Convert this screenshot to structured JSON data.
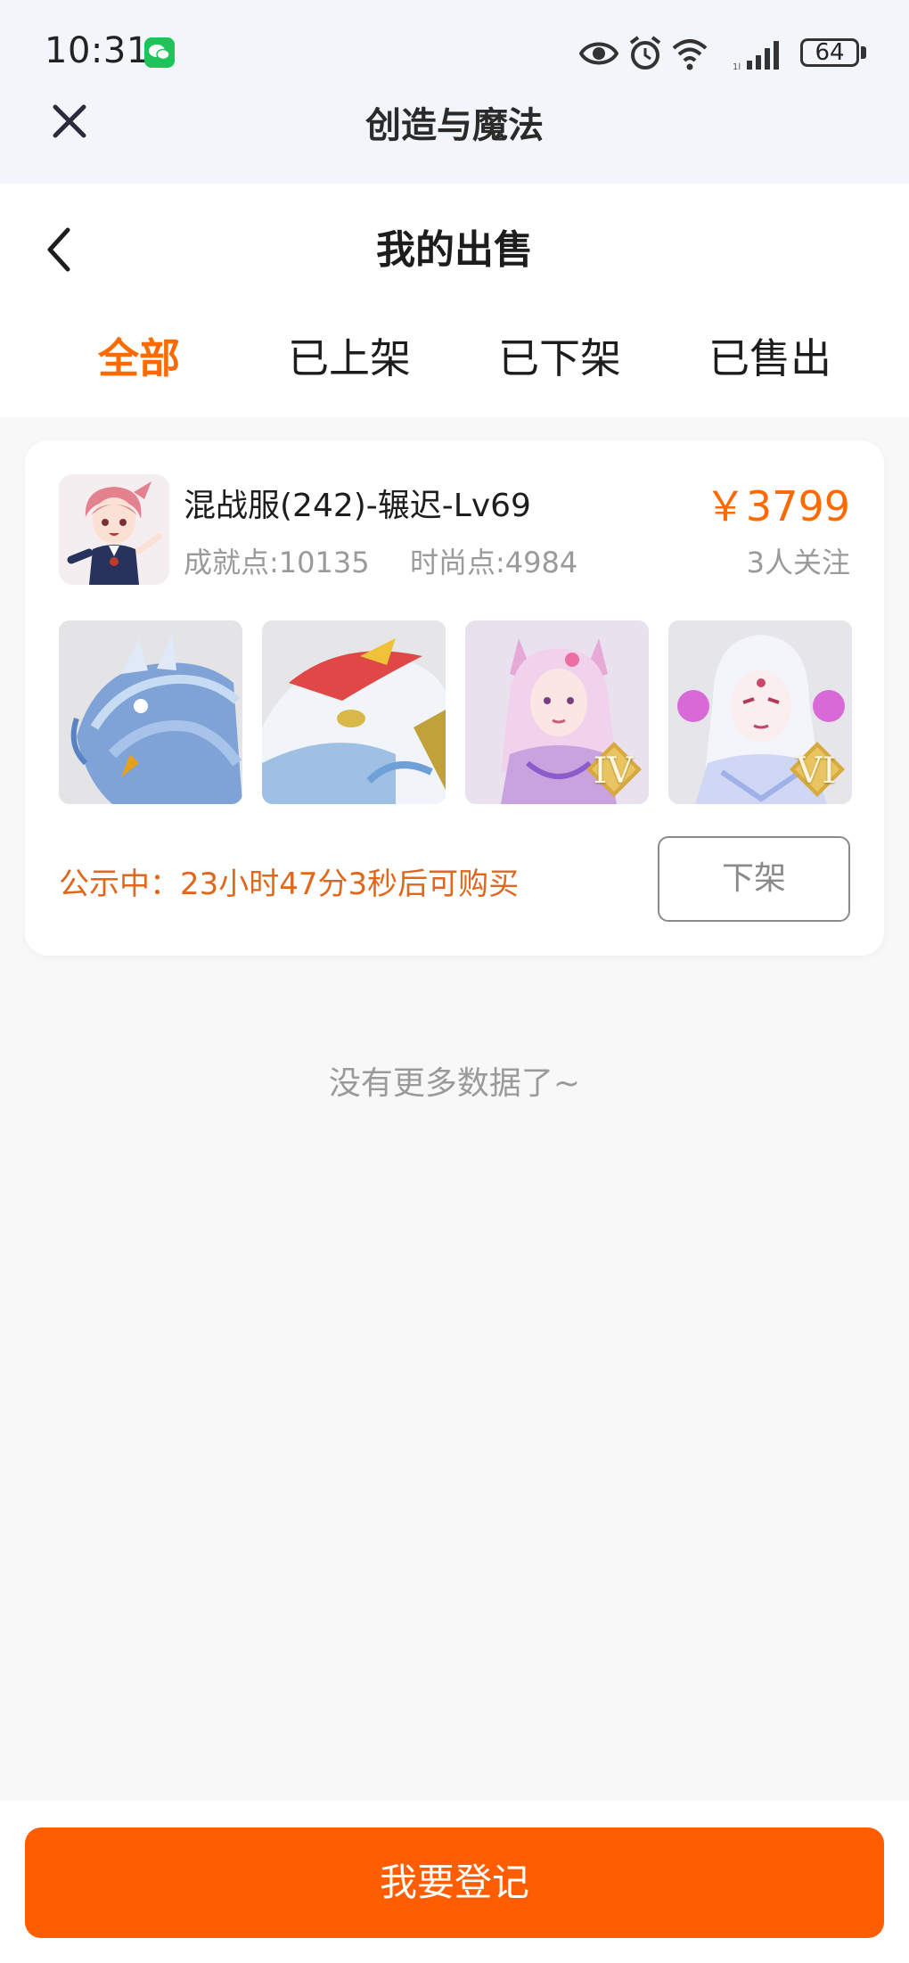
{
  "status_bar": {
    "time": "10:31",
    "battery": "64",
    "icons": [
      "wechat-icon",
      "eye-icon",
      "alarm-icon",
      "wifi-icon",
      "signal-icon",
      "battery-icon"
    ]
  },
  "app": {
    "title": "创造与魔法",
    "close_icon": "close-icon"
  },
  "header": {
    "title": "我的出售",
    "back_icon": "chevron-left-icon"
  },
  "tabs": [
    {
      "label": "全部",
      "active": true
    },
    {
      "label": "已上架",
      "active": false
    },
    {
      "label": "已下架",
      "active": false
    },
    {
      "label": "已售出",
      "active": false
    }
  ],
  "listing": {
    "title": "混战服(242)-辗迟-Lv69",
    "achievement": "成就点:10135",
    "fashion": "时尚点:4984",
    "price": "￥3799",
    "followers": "3人关注",
    "thumbnails": [
      {
        "name": "blue-dragon",
        "rank": ""
      },
      {
        "name": "red-white-fish",
        "rank": ""
      },
      {
        "name": "fox-girl",
        "rank": "IV"
      },
      {
        "name": "white-hair-girl",
        "rank": "VI"
      }
    ],
    "notice": "公示中：23小时47分3秒后可购买",
    "delist_label": "下架"
  },
  "footer_note": "没有更多数据了~",
  "bottom": {
    "register_label": "我要登记"
  },
  "colors": {
    "accent": "#ff6a00",
    "button": "#ff5d00",
    "notice": "#e0671b"
  }
}
